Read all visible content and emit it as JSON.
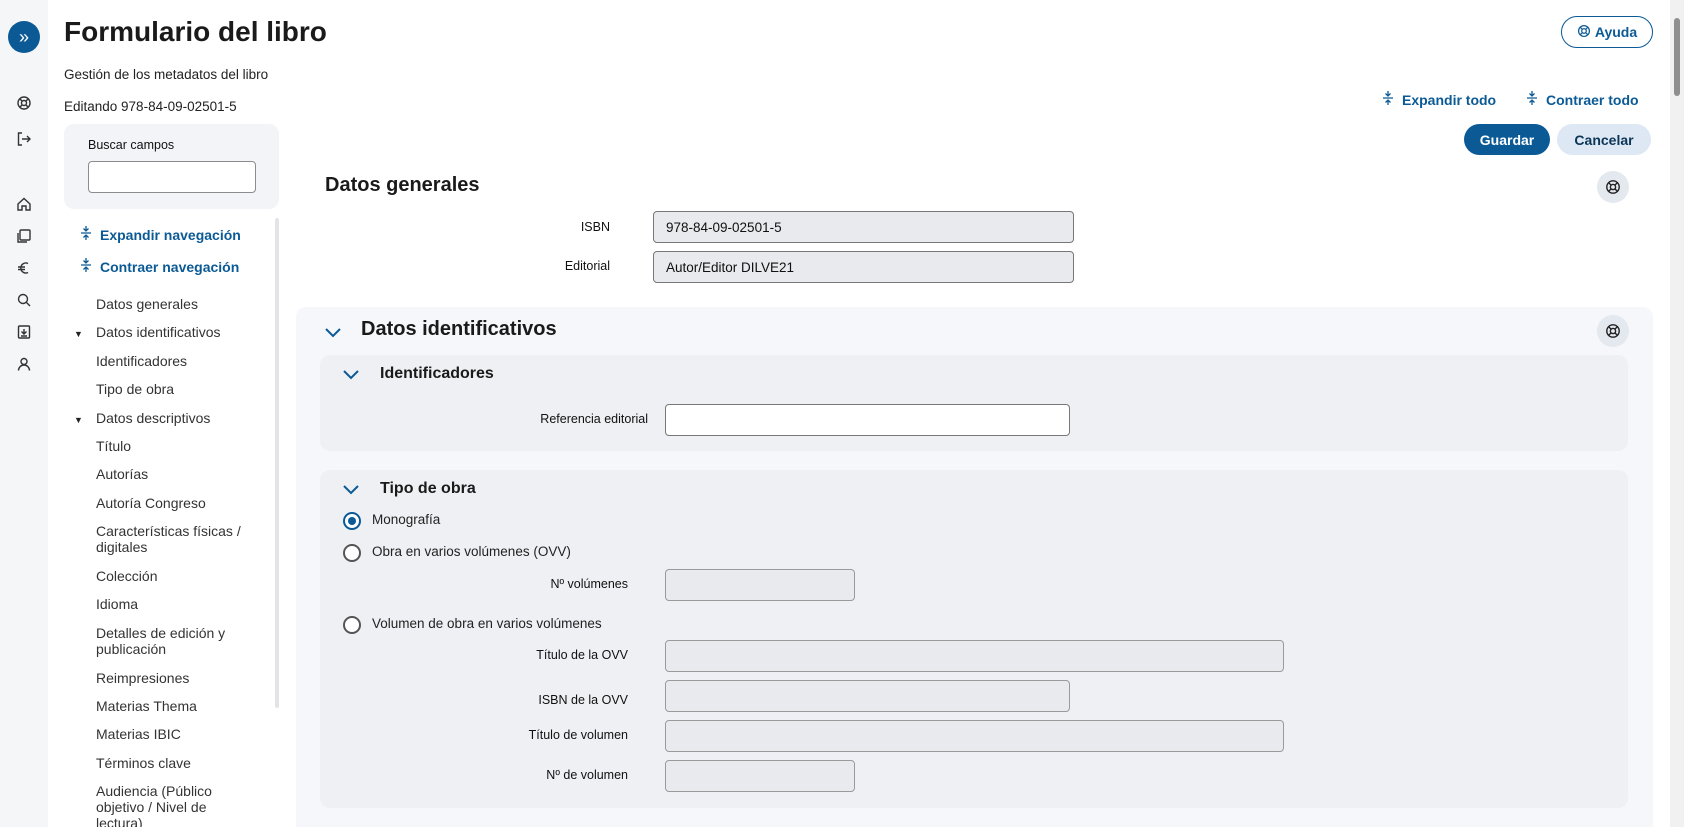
{
  "header": {
    "title": "Formulario del libro",
    "subtitle": "Gestión de los metadatos del libro",
    "editing": "Editando 978-84-09-02501-5",
    "help_label": "Ayuda",
    "expand_all": "Expandir todo",
    "collapse_all": "Contraer todo",
    "save_label": "Guardar",
    "cancel_label": "Cancelar"
  },
  "rail": {
    "icons": [
      "menu-expand-icon",
      "lifebuoy-icon",
      "logout-icon",
      "home-icon",
      "books-icon",
      "euro-icon",
      "search-icon",
      "download-icon",
      "user-icon"
    ]
  },
  "nav": {
    "search_label": "Buscar campos",
    "search_value": "",
    "expand_nav": "Expandir navegación",
    "collapse_nav": "Contraer navegación",
    "items": [
      {
        "label": "Datos generales",
        "level": 0
      },
      {
        "label": "Datos identificativos",
        "level": 0,
        "expanded": true
      },
      {
        "label": "Identificadores",
        "level": 1
      },
      {
        "label": "Tipo de obra",
        "level": 1
      },
      {
        "label": "Datos descriptivos",
        "level": 0,
        "expanded": true
      },
      {
        "label": "Título",
        "level": 1
      },
      {
        "label": "Autorías",
        "level": 1
      },
      {
        "label": "Autoría Congreso",
        "level": 1
      },
      {
        "label": "Características físicas / digitales",
        "level": 1
      },
      {
        "label": "Colección",
        "level": 1
      },
      {
        "label": "Idioma",
        "level": 1
      },
      {
        "label": "Detalles de edición y publicación",
        "level": 1
      },
      {
        "label": "Reimpresiones",
        "level": 1
      },
      {
        "label": "Materias Thema",
        "level": 1
      },
      {
        "label": "Materias IBIC",
        "level": 1
      },
      {
        "label": "Términos clave",
        "level": 1
      },
      {
        "label": "Audiencia (Público objetivo / Nivel de lectura)",
        "level": 1
      }
    ]
  },
  "general": {
    "title": "Datos generales",
    "isbn_label": "ISBN",
    "isbn_value": "978-84-09-02501-5",
    "publisher_label": "Editorial",
    "publisher_value": "Autor/Editor DILVE21"
  },
  "identification": {
    "title": "Datos identificativos",
    "identifiers": {
      "title": "Identificadores",
      "ref_label": "Referencia editorial",
      "ref_value": ""
    },
    "work_type": {
      "title": "Tipo de obra",
      "options": [
        {
          "label": "Monografía",
          "selected": true
        },
        {
          "label": "Obra en varios volúmenes (OVV)",
          "selected": false
        },
        {
          "label": "Volumen de obra en varios volúmenes",
          "selected": false
        }
      ],
      "volumes_label": "Nº volúmenes",
      "ovv_title_label": "Título de la OVV",
      "ovv_isbn_label": "ISBN de la OVV",
      "volume_title_label": "Título de volumen",
      "volume_number_label": "Nº de volumen"
    }
  },
  "colors": {
    "accent": "#0b5a96",
    "panel_bg": "#f6f7fa",
    "subpanel_bg": "#eef0f4",
    "disabled_bg": "#e8eaed"
  }
}
